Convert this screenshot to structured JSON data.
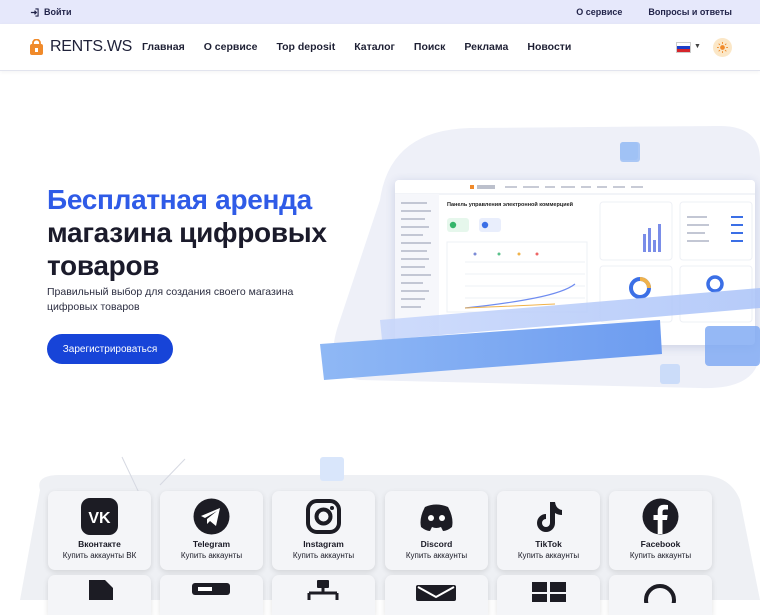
{
  "topbar": {
    "login": "Войти",
    "links": [
      "О сервисе",
      "Вопросы и ответы"
    ]
  },
  "brand": {
    "logo_text": "RENTS.WS",
    "accent": "#2f5be7",
    "button": "#1744d8"
  },
  "nav": {
    "items": [
      "Главная",
      "О сервисе",
      "Top deposit",
      "Каталог",
      "Поиск",
      "Реклама",
      "Новости"
    ]
  },
  "lang": {
    "selected": "ru-flag"
  },
  "hero": {
    "title_accent": "Бесплатная аренда",
    "title_line2": "магазина цифровых",
    "title_line3": "товаров",
    "subtitle": "Правильный выбор для создания своего магазина цифровых товаров",
    "cta": "Зарегистрироваться"
  },
  "mock": {
    "title": "Панель управления электронной коммерцией"
  },
  "services": [
    {
      "name": "Вконтакте",
      "desc": "Купить аккаунты ВК",
      "icon": "vk-icon"
    },
    {
      "name": "Telegram",
      "desc": "Купить аккаунты",
      "icon": "telegram-icon"
    },
    {
      "name": "Instagram",
      "desc": "Купить аккаунты",
      "icon": "instagram-icon"
    },
    {
      "name": "Discord",
      "desc": "Купить аккаунты",
      "icon": "discord-icon"
    },
    {
      "name": "TikTok",
      "desc": "Купить аккаунты",
      "icon": "tiktok-icon"
    },
    {
      "name": "Facebook",
      "desc": "Купить аккаунты",
      "icon": "facebook-icon"
    }
  ]
}
